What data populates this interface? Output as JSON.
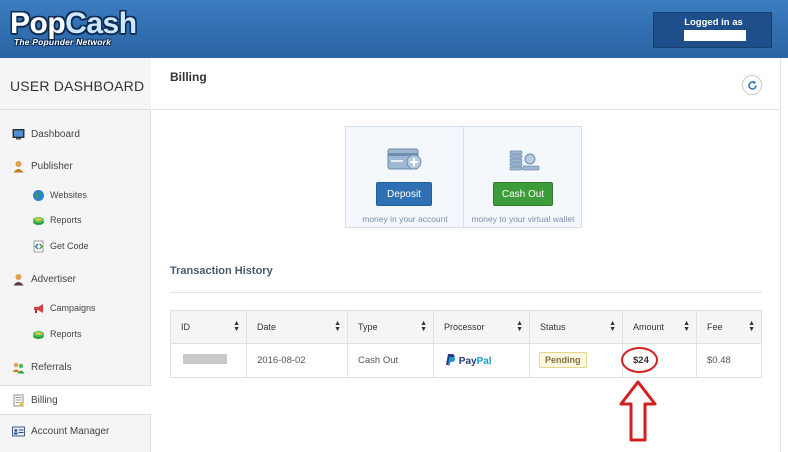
{
  "header": {
    "logo_main_pop": "Pop",
    "logo_main_cash": "Cash",
    "logo_tagline": "The Popunder Network",
    "logged_in_label": "Logged in as"
  },
  "sidebar": {
    "title": "USER DASHBOARD",
    "items": [
      {
        "label": "Dashboard",
        "icon": "monitor-icon"
      },
      {
        "label": "Publisher",
        "icon": "user-icon"
      },
      {
        "label": "Websites",
        "icon": "globe-icon"
      },
      {
        "label": "Reports",
        "icon": "coins-icon"
      },
      {
        "label": "Get Code",
        "icon": "code-icon"
      },
      {
        "label": "Advertiser",
        "icon": "advertiser-icon"
      },
      {
        "label": "Campaigns",
        "icon": "megaphone-icon"
      },
      {
        "label": "Reports",
        "icon": "coins-icon"
      },
      {
        "label": "Referrals",
        "icon": "users-icon"
      },
      {
        "label": "Billing",
        "icon": "document-icon"
      },
      {
        "label": "Account Manager",
        "icon": "id-card-icon"
      }
    ]
  },
  "main": {
    "title": "Billing",
    "deposit_label": "Deposit",
    "deposit_caption": "money in your account",
    "cashout_label": "Cash Out",
    "cashout_caption": "money to your virtual wallet",
    "section_title": "Transaction History",
    "table": {
      "headers": [
        "ID",
        "Date",
        "Type",
        "Processor",
        "Status",
        "Amount",
        "Fee"
      ],
      "rows": [
        {
          "date": "2016-08-02",
          "type": "Cash Out",
          "processor_a": "Pay",
          "processor_b": "Pal",
          "status": "Pending",
          "amount": "$24",
          "fee": "$0.48"
        }
      ]
    }
  },
  "colors": {
    "header_blue": "#2b64a3",
    "deposit_blue": "#2f6fb3",
    "cashout_green": "#3e9b3a",
    "annotation_red": "#d21f1f"
  }
}
